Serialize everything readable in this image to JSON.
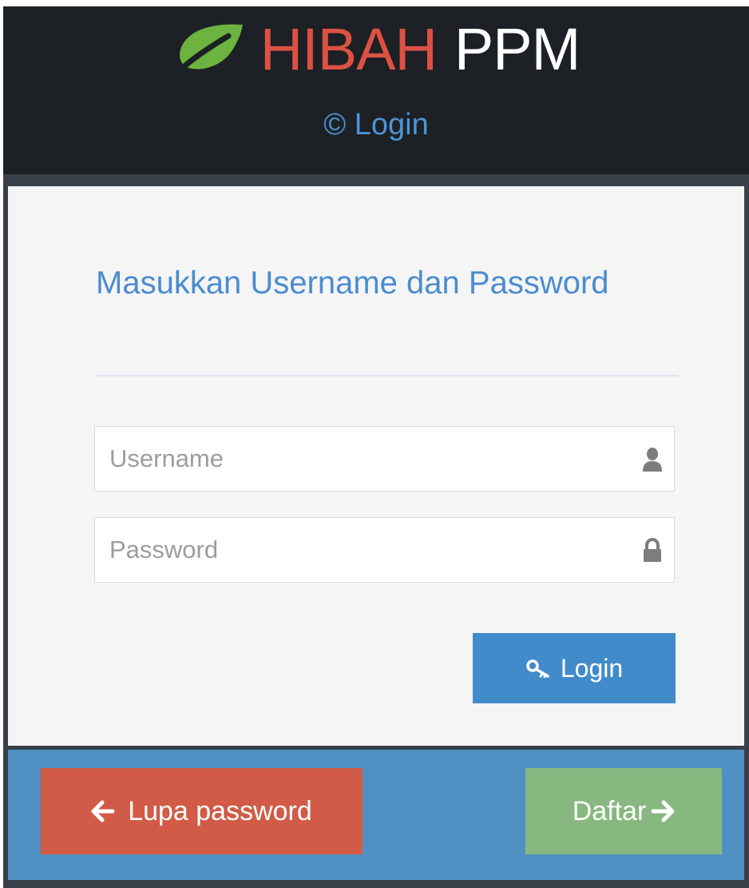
{
  "header": {
    "brand_primary": "HIBAH",
    "brand_secondary": "PPM",
    "logo_icon": "leaf-icon",
    "subtitle": "© Login"
  },
  "login_form": {
    "heading": "Masukkan Username dan Password",
    "username": {
      "placeholder": "Username",
      "value": "",
      "icon": "user-icon"
    },
    "password": {
      "placeholder": "Password",
      "value": "",
      "icon": "lock-icon"
    },
    "submit": {
      "label": "Login",
      "icon": "key-icon"
    }
  },
  "footer": {
    "forgot_password": {
      "label": "Lupa password",
      "icon": "arrow-left-icon"
    },
    "register": {
      "label": "Daftar",
      "icon": "arrow-right-icon"
    }
  },
  "colors": {
    "header_bg": "#1d2024",
    "brand_red": "#dd5143",
    "accent_blue": "#428bca",
    "card_bg": "#f5f5f5",
    "footer_bg": "#5090c2",
    "forgot_bg": "#d15b47",
    "register_bg": "#87b87f"
  }
}
